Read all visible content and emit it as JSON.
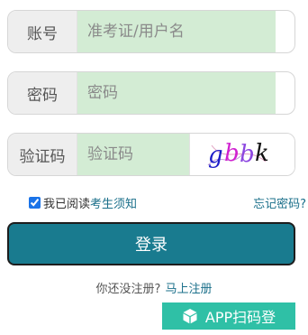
{
  "username": {
    "label": "账号",
    "placeholder": "准考证/用户名"
  },
  "password": {
    "label": "密码",
    "placeholder": "密码"
  },
  "captcha": {
    "label": "验证码",
    "placeholder": "验证码",
    "image_text": "gbbk"
  },
  "agree": {
    "prefix": "我已阅读",
    "link": "考生须知",
    "checked": true
  },
  "forgot_password": "忘记密码?",
  "login_button": "登录",
  "register": {
    "prompt": "你还没注册?",
    "link": "马上注册"
  },
  "app_login": {
    "label": "APP扫码登",
    "icon": "cube-icon"
  },
  "colors": {
    "accent": "#197b8f",
    "input_bg": "#d3ecd4",
    "app_btn": "#2fc0a6",
    "link": "#1a6f8a"
  }
}
